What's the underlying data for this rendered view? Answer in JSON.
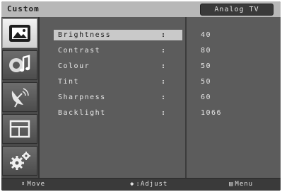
{
  "header": {
    "title": "Custom",
    "source": "Analog TV"
  },
  "sidebar": {
    "items": [
      {
        "icon": "picture-icon",
        "active": true
      },
      {
        "icon": "sound-icon",
        "active": false
      },
      {
        "icon": "satellite-dish-icon",
        "active": false
      },
      {
        "icon": "screen-layout-icon",
        "active": false
      },
      {
        "icon": "gears-icon",
        "active": false
      }
    ]
  },
  "settings": [
    {
      "label": "Brightness",
      "colon": ":",
      "value": "40"
    },
    {
      "label": "Contrast",
      "colon": ":",
      "value": "80"
    },
    {
      "label": "Colour",
      "colon": ":",
      "value": "50"
    },
    {
      "label": "Tint",
      "colon": ":",
      "value": "50"
    },
    {
      "label": "Sharpness",
      "colon": ":",
      "value": "60"
    },
    {
      "label": "Backlight",
      "colon": ":",
      "value": "1066"
    }
  ],
  "footer": {
    "move_symbol": "⬍",
    "move_label": "Move",
    "adjust_symbol": "◆",
    "adjust_label": ":Adjust",
    "menu_symbol": "▤",
    "menu_label": "Menu"
  }
}
